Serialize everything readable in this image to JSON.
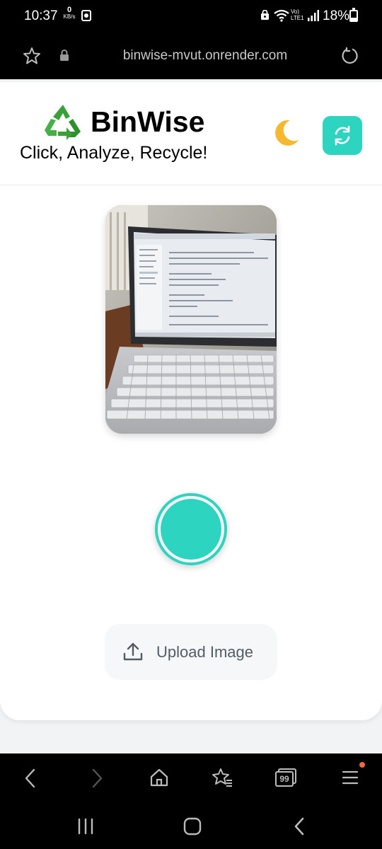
{
  "status_bar": {
    "time": "10:37",
    "net_speed_value": "0",
    "net_speed_unit": "KB/s",
    "network_label_top": "Vo)",
    "network_label_bottom": "LTE1",
    "battery": "18%"
  },
  "browser": {
    "url": "binwise-mvut.onrender.com"
  },
  "app": {
    "brand": "BinWise",
    "tagline": "Click, Analyze, Recycle!",
    "theme_icon": "moon-icon",
    "switch_camera_icon": "camera-switch-icon",
    "upload_label": "Upload Image",
    "accent_color": "#2dd4bf"
  },
  "bottom_nav": {
    "tabs_count": "99"
  }
}
